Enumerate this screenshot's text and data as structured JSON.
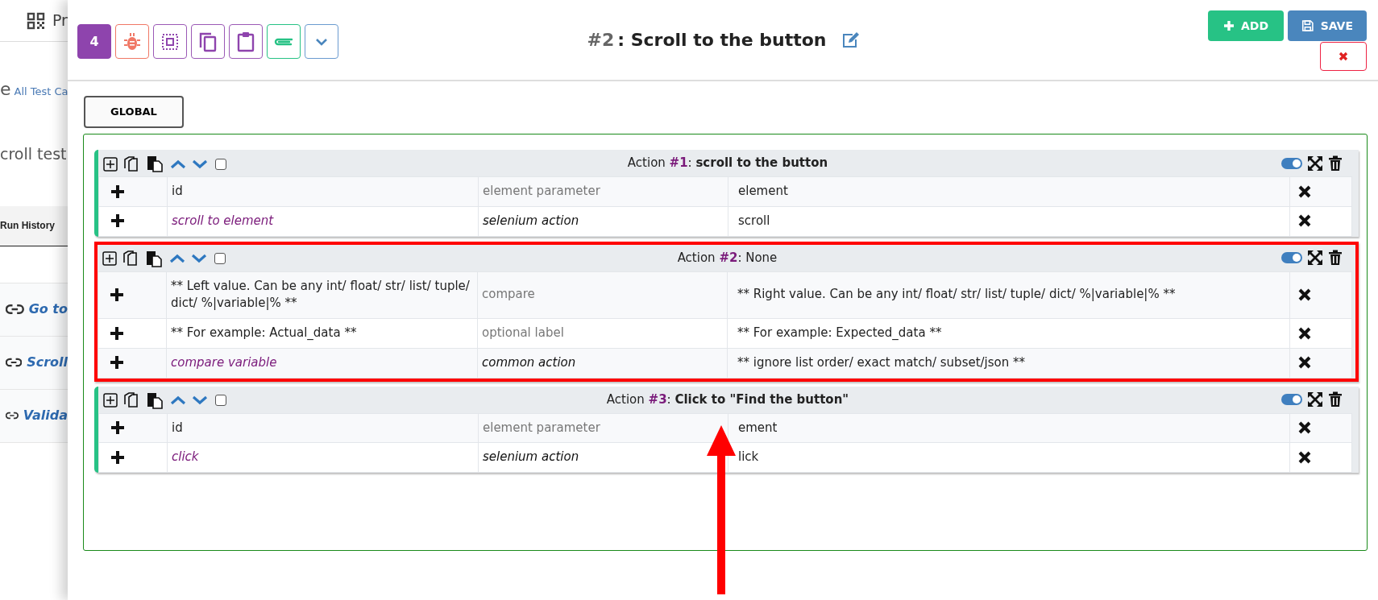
{
  "background_page": {
    "nav_text": "Pr",
    "breadcrumb_prefix": "e",
    "breadcrumb_link": "All Test Ca",
    "heading": "croll test",
    "tab": "Run History",
    "links": [
      "Go to",
      "Scroll",
      "Valida"
    ]
  },
  "toolbar": [
    {
      "kind": "count",
      "label": "4"
    },
    {
      "kind": "bug"
    },
    {
      "kind": "select"
    },
    {
      "kind": "copy"
    },
    {
      "kind": "clipboard"
    },
    {
      "kind": "attach"
    },
    {
      "kind": "dropdown"
    }
  ],
  "step": {
    "number": "#2",
    "title": ": Scroll to the button"
  },
  "buttons": {
    "add": "ADD",
    "save": "SAVE"
  },
  "global_tab": "GLOBAL",
  "actions": [
    {
      "title": "Action **#1**: **scroll to the button**",
      "checked": false,
      "enabled": true,
      "highlighted": false,
      "rows": [
        {
          "kind": "parameter",
          "field": "id",
          "type": "element parameter",
          "value": "element"
        },
        {
          "kind": "action",
          "field": "scroll to element",
          "type": "selenium action",
          "value": "scroll"
        }
      ]
    },
    {
      "title": "Action **#2**: None",
      "checked": false,
      "enabled": true,
      "highlighted": true,
      "rows": [
        {
          "kind": "parameter",
          "field": "** Left value. Can be any int/ float/ str/ list/ tuple/ dict/ %|variable|% **",
          "type": "compare",
          "value": "** Right value. Can be any int/ float/ str/ list/ tuple/ dict/ %|variable|% **"
        },
        {
          "kind": "parameter",
          "field": "** For example: Actual_data **",
          "type": "optional label",
          "value": "** For example: Expected_data **"
        },
        {
          "kind": "action",
          "field": "compare variable",
          "type": "common action",
          "value": "** ignore list order/ exact match/ subset/json **"
        }
      ]
    },
    {
      "title": "Action **#3**: **Click to \"Find the button\"**",
      "checked": false,
      "enabled": true,
      "highlighted": false,
      "rows": [
        {
          "kind": "parameter",
          "field": "id",
          "type": "element parameter",
          "value": "ement"
        },
        {
          "kind": "action",
          "field": "click",
          "type": "selenium action",
          "value": "lick"
        }
      ]
    }
  ]
}
